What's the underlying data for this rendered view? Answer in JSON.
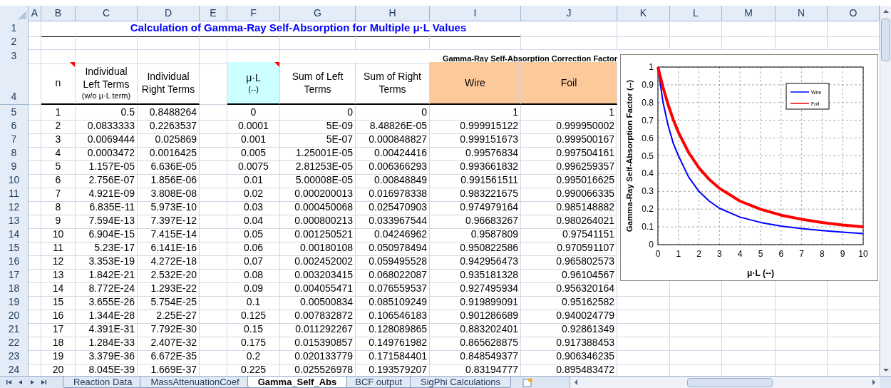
{
  "column_letters": [
    "A",
    "B",
    "C",
    "D",
    "E",
    "F",
    "G",
    "H",
    "I",
    "J",
    "K",
    "L",
    "M",
    "N",
    "O"
  ],
  "top_row_numbers": [
    "1",
    "2",
    "3",
    "4"
  ],
  "title": "Calculation of Gamma-Ray Self-Absorption for Multiple μ·L Values",
  "group_header": "Gamma-Ray Self-Absorption Correction Factor",
  "table": {
    "columns": [
      {
        "label": "n",
        "comment": true
      },
      {
        "label": "Individual Left Terms",
        "sublabel": "(w/o μ·L term)",
        "comment": false
      },
      {
        "label": "Individual Right Terms",
        "comment": false
      },
      {
        "label": "μ·L",
        "sublabel": "(--)",
        "comment": true,
        "color": "#ccffff"
      },
      {
        "label": "Sum of Left Terms",
        "comment": false
      },
      {
        "label": "Sum of Right Terms",
        "comment": false
      },
      {
        "label": "Wire",
        "comment": false,
        "color": "#fcc99b"
      },
      {
        "label": "Foil",
        "comment": false,
        "color": "#fcc99b"
      }
    ],
    "rows": [
      {
        "number": "5",
        "cells": [
          "1",
          "0.5",
          "0.8488264",
          "0",
          "0",
          "0",
          "1",
          "1"
        ]
      },
      {
        "number": "6",
        "cells": [
          "2",
          "0.0833333",
          "0.2263537",
          "0.0001",
          "5E-09",
          "8.48826E-05",
          "0.999915122",
          "0.999950002"
        ]
      },
      {
        "number": "7",
        "cells": [
          "3",
          "0.0069444",
          "0.025869",
          "0.001",
          "5E-07",
          "0.000848827",
          "0.999151673",
          "0.999500167"
        ]
      },
      {
        "number": "8",
        "cells": [
          "4",
          "0.0003472",
          "0.0016425",
          "0.005",
          "1.25001E-05",
          "0.00424416",
          "0.99576834",
          "0.997504161"
        ]
      },
      {
        "number": "9",
        "cells": [
          "5",
          "1.157E-05",
          "6.636E-05",
          "0.0075",
          "2.81253E-05",
          "0.006366293",
          "0.993661832",
          "0.996259357"
        ]
      },
      {
        "number": "10",
        "cells": [
          "6",
          "2.756E-07",
          "1.856E-06",
          "0.01",
          "5.00008E-05",
          "0.00848849",
          "0.991561511",
          "0.995016625"
        ]
      },
      {
        "number": "11",
        "cells": [
          "7",
          "4.921E-09",
          "3.808E-08",
          "0.02",
          "0.000200013",
          "0.016978338",
          "0.983221675",
          "0.990066335"
        ]
      },
      {
        "number": "12",
        "cells": [
          "8",
          "6.835E-11",
          "5.973E-10",
          "0.03",
          "0.000450068",
          "0.025470903",
          "0.974979164",
          "0.985148882"
        ]
      },
      {
        "number": "13",
        "cells": [
          "9",
          "7.594E-13",
          "7.397E-12",
          "0.04",
          "0.000800213",
          "0.033967544",
          "0.96683267",
          "0.980264021"
        ]
      },
      {
        "number": "14",
        "cells": [
          "10",
          "6.904E-15",
          "7.415E-14",
          "0.05",
          "0.001250521",
          "0.04246962",
          "0.9587809",
          "0.97541151"
        ]
      },
      {
        "number": "15",
        "cells": [
          "11",
          "5.23E-17",
          "6.141E-16",
          "0.06",
          "0.00180108",
          "0.050978494",
          "0.950822586",
          "0.970591107"
        ]
      },
      {
        "number": "16",
        "cells": [
          "12",
          "3.353E-19",
          "4.272E-18",
          "0.07",
          "0.002452002",
          "0.059495528",
          "0.942956473",
          "0.965802573"
        ]
      },
      {
        "number": "17",
        "cells": [
          "13",
          "1.842E-21",
          "2.532E-20",
          "0.08",
          "0.003203415",
          "0.068022087",
          "0.935181328",
          "0.96104567"
        ]
      },
      {
        "number": "18",
        "cells": [
          "14",
          "8.772E-24",
          "1.293E-22",
          "0.09",
          "0.004055471",
          "0.076559537",
          "0.927495934",
          "0.956320164"
        ]
      },
      {
        "number": "19",
        "cells": [
          "15",
          "3.655E-26",
          "5.754E-25",
          "0.1",
          "0.00500834",
          "0.085109249",
          "0.919899091",
          "0.95162582"
        ]
      },
      {
        "number": "20",
        "cells": [
          "16",
          "1.344E-28",
          "2.25E-27",
          "0.125",
          "0.007832872",
          "0.106546183",
          "0.901286689",
          "0.940024779"
        ]
      },
      {
        "number": "21",
        "cells": [
          "17",
          "4.391E-31",
          "7.792E-30",
          "0.15",
          "0.011292267",
          "0.128089865",
          "0.883202401",
          "0.92861349"
        ]
      },
      {
        "number": "22",
        "cells": [
          "18",
          "1.284E-33",
          "2.407E-32",
          "0.175",
          "0.015390857",
          "0.149761982",
          "0.865628875",
          "0.917388453"
        ]
      },
      {
        "number": "23",
        "cells": [
          "19",
          "3.379E-36",
          "6.672E-35",
          "0.2",
          "0.020133779",
          "0.171584401",
          "0.848549377",
          "0.906346235"
        ]
      },
      {
        "number": "24",
        "cells": [
          "20",
          "8.045E-39",
          "1.669E-37",
          "0.225",
          "0.025526978",
          "0.193579207",
          "0.83194777",
          "0.895483472"
        ]
      }
    ]
  },
  "chart": {
    "chart_data": {
      "type": "line",
      "xlabel": "μ·L (--)",
      "ylabel": "Gamma-Ray Self-Absorption Factor (--)",
      "x": [
        0,
        0.25,
        0.5,
        0.75,
        1,
        1.5,
        2,
        2.5,
        3,
        4,
        5,
        6,
        7,
        8,
        9,
        10
      ],
      "series": [
        {
          "name": "Wire",
          "color": "#0000ff",
          "values": [
            1,
            0.8,
            0.67,
            0.57,
            0.5,
            0.38,
            0.3,
            0.245,
            0.205,
            0.155,
            0.125,
            0.105,
            0.09,
            0.079,
            0.07,
            0.062
          ]
        },
        {
          "name": "Foil",
          "color": "#ff0000",
          "values": [
            1,
            0.885,
            0.787,
            0.703,
            0.632,
            0.518,
            0.432,
            0.367,
            0.317,
            0.245,
            0.199,
            0.166,
            0.143,
            0.125,
            0.111,
            0.1
          ]
        }
      ],
      "xlim": [
        0,
        10
      ],
      "ylim": [
        0,
        1
      ],
      "grid": true,
      "legend": true,
      "xticks": [
        {
          "value": 0,
          "label": "0"
        },
        {
          "value": 1,
          "label": "1"
        },
        {
          "value": 2,
          "label": "2"
        },
        {
          "value": 3,
          "label": "3"
        },
        {
          "value": 4,
          "label": "4"
        },
        {
          "value": 5,
          "label": "5"
        },
        {
          "value": 6,
          "label": "6"
        },
        {
          "value": 7,
          "label": "7"
        },
        {
          "value": 8,
          "label": "8"
        },
        {
          "value": 9,
          "label": "9"
        },
        {
          "value": 10,
          "label": "10"
        }
      ],
      "yticks": [
        {
          "value": 0,
          "label": "0"
        },
        {
          "value": 0.1,
          "label": "0.1"
        },
        {
          "value": 0.2,
          "label": "0.2"
        },
        {
          "value": 0.3,
          "label": "0.3"
        },
        {
          "value": 0.4,
          "label": "0.4"
        },
        {
          "value": 0.5,
          "label": "0.5"
        },
        {
          "value": 0.6,
          "label": "0.6"
        },
        {
          "value": 0.7,
          "label": "0.7"
        },
        {
          "value": 0.8,
          "label": "0.8"
        },
        {
          "value": 0.9,
          "label": "0.9"
        },
        {
          "value": 1,
          "label": "1"
        }
      ]
    }
  },
  "sheet_tabs": [
    {
      "label": "Reaction Data",
      "selected": false
    },
    {
      "label": "MassAttenuationCoef",
      "selected": false
    },
    {
      "label": "Gamma_Self_Abs",
      "selected": true
    },
    {
      "label": "BCF output",
      "selected": false
    },
    {
      "label": "SigPhi Calculations",
      "selected": false
    }
  ]
}
